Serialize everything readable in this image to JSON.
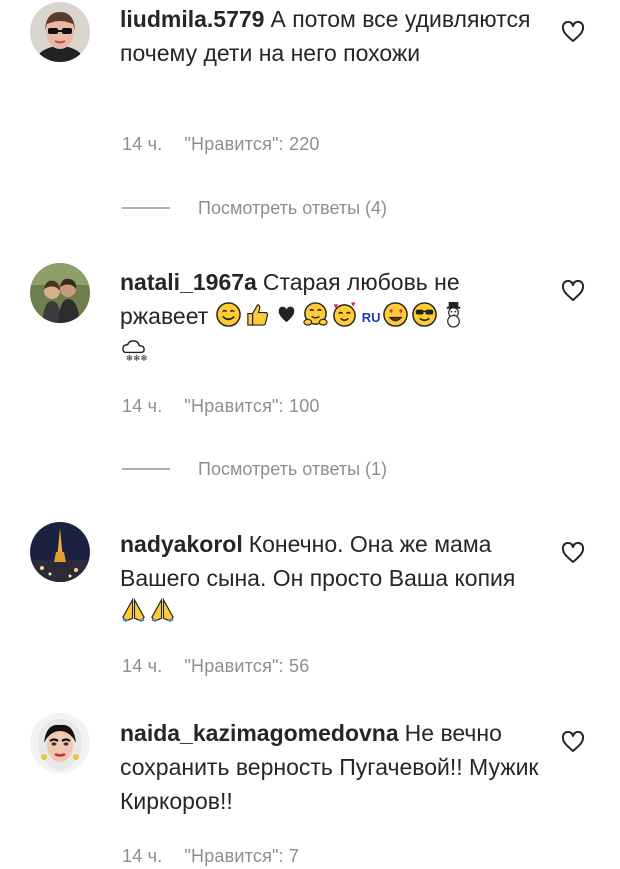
{
  "comments": [
    {
      "username": "liudmila.5779",
      "text": "А потом все удивляются почему дети на него похожи",
      "time": "14 ч.",
      "likes": "\"Нравится\": 220",
      "replies": "Посмотреть ответы (4)"
    },
    {
      "username": "natali_1967a",
      "text": "Старая любовь не ржавеет",
      "emoji_text": "RU",
      "emojis": [
        "smiling-face-icon",
        "thumbs-up-icon",
        "black-heart-icon",
        "hugging-face-icon",
        "face-with-hearts-icon",
        "ru-flag-icon",
        "heart-eyes-icon",
        "sunglasses-face-icon",
        "snowman-icon",
        "snow-cloud-icon"
      ],
      "time": "14 ч.",
      "likes": "\"Нравится\": 100",
      "replies": "Посмотреть ответы (1)"
    },
    {
      "username": "nadyakorol",
      "text": "Конечно. Она же мама Вашего сына. Он просто Ваша копия",
      "emojis": [
        "folded-hands-icon",
        "folded-hands-icon"
      ],
      "time": "14 ч.",
      "likes": "\"Нравится\": 56"
    },
    {
      "username": "naida_kazimagomedovna",
      "text": "Не вечно сохранить верность Пугачевой!! Мужик Киркоров!!",
      "time": "14 ч.",
      "likes": "\"Нравится\": 7"
    }
  ],
  "colors": {
    "text": "#262626",
    "secondary": "#8e8e8e"
  }
}
